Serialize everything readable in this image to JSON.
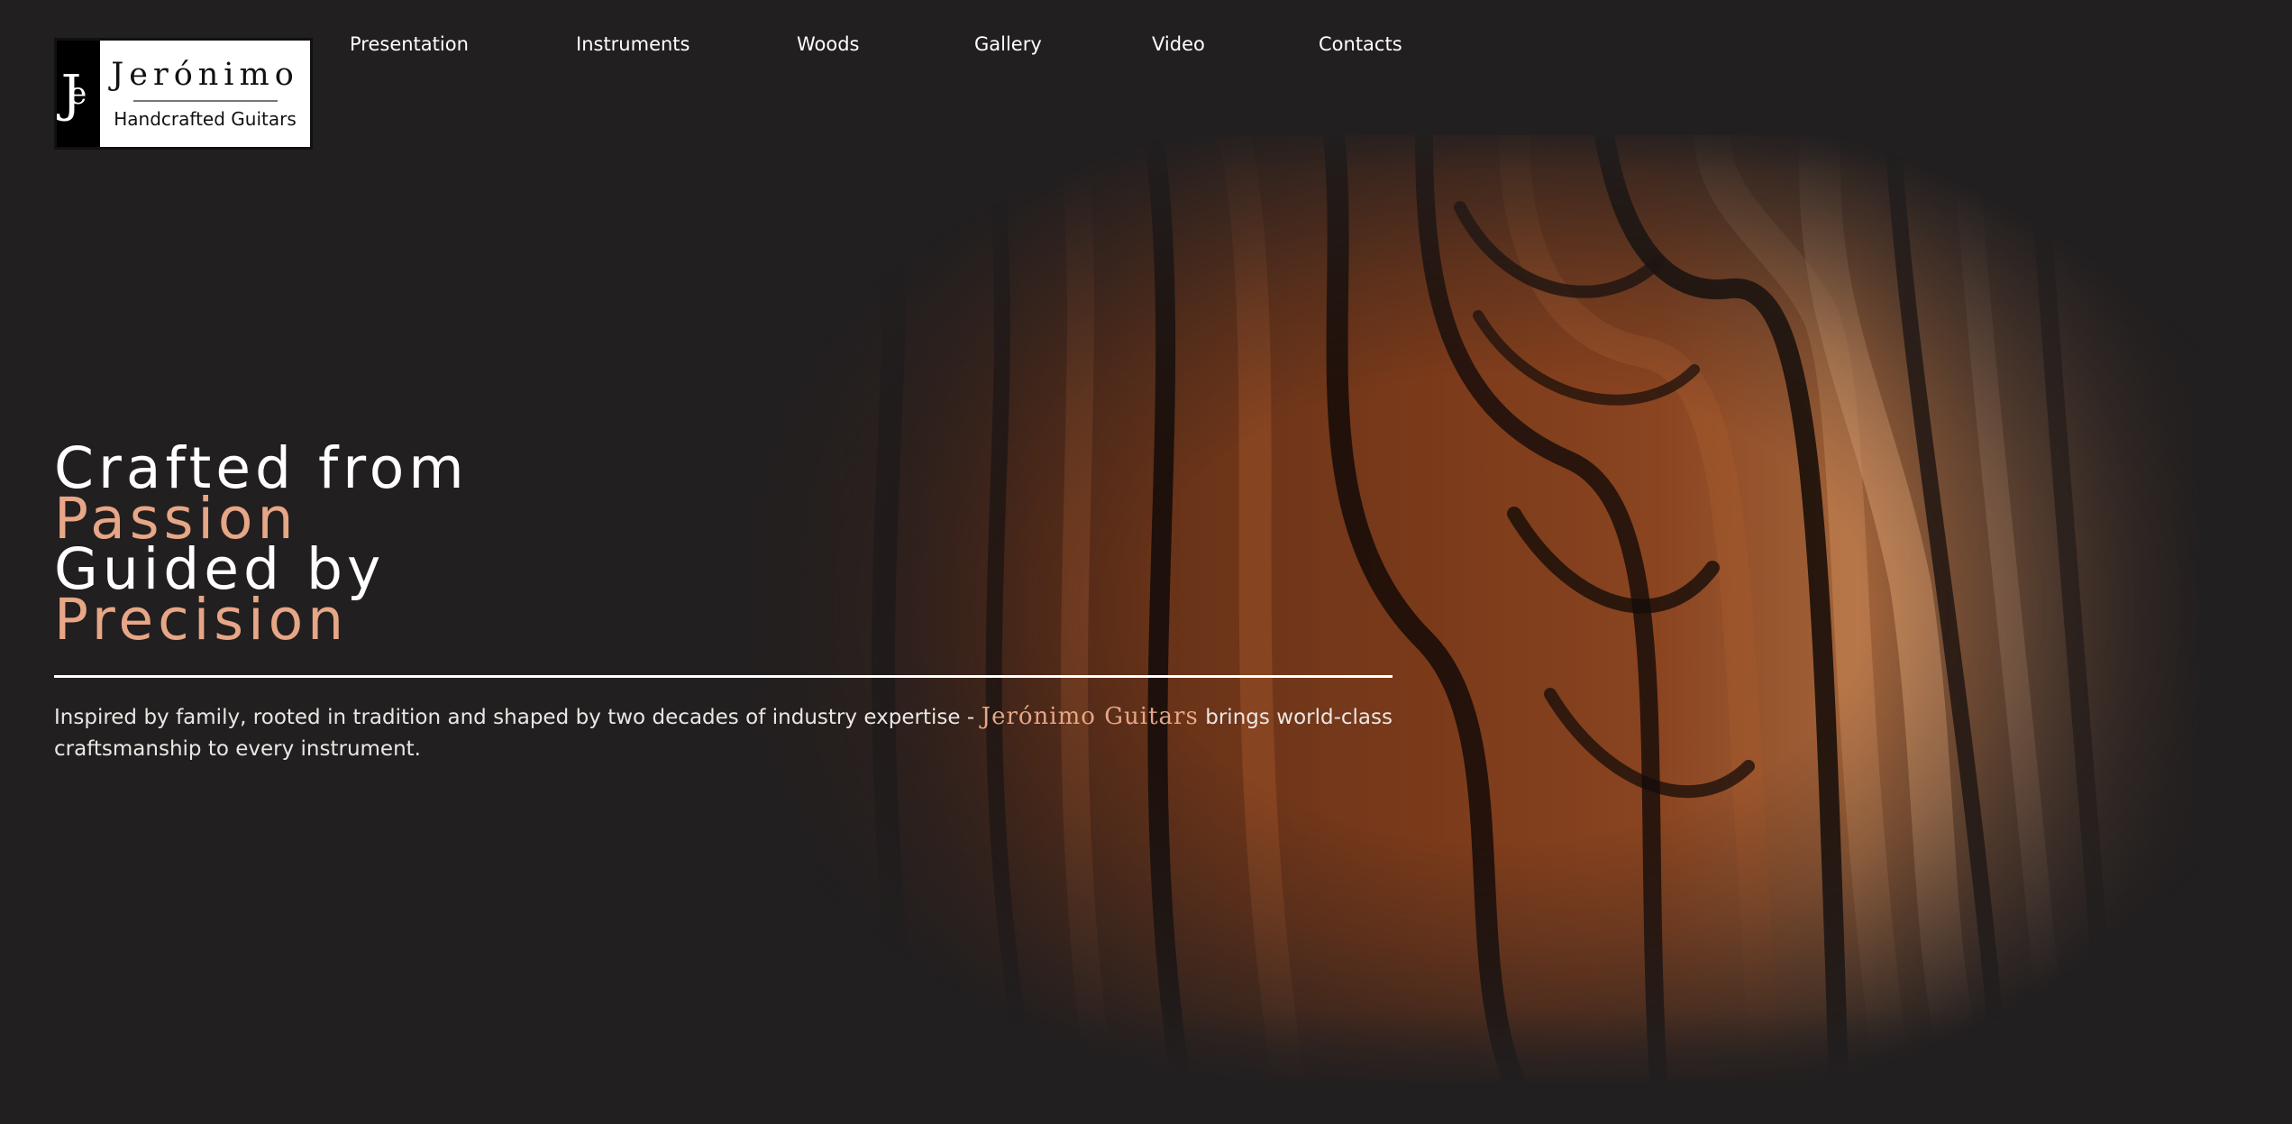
{
  "logo": {
    "mark": "J",
    "mark_sub": "e",
    "name": "Jerónimo",
    "tagline": "Handcrafted Guitars"
  },
  "nav": {
    "items": [
      "Presentation",
      "Instruments",
      "Woods",
      "Gallery",
      "Video",
      "Contacts"
    ]
  },
  "hero": {
    "line1": "Crafted from",
    "line2": "Passion",
    "line3": "Guided by",
    "line4": "Precision",
    "desc_before": "Inspired by family, rooted in tradition and shaped by two decades of industry expertise - ",
    "desc_brand": "Jerónimo Guitars",
    "desc_after": " brings world-class craftsmanship to every instrument."
  },
  "colors": {
    "background": "#221f20",
    "accent": "#e7a686",
    "text": "#ffffff"
  }
}
